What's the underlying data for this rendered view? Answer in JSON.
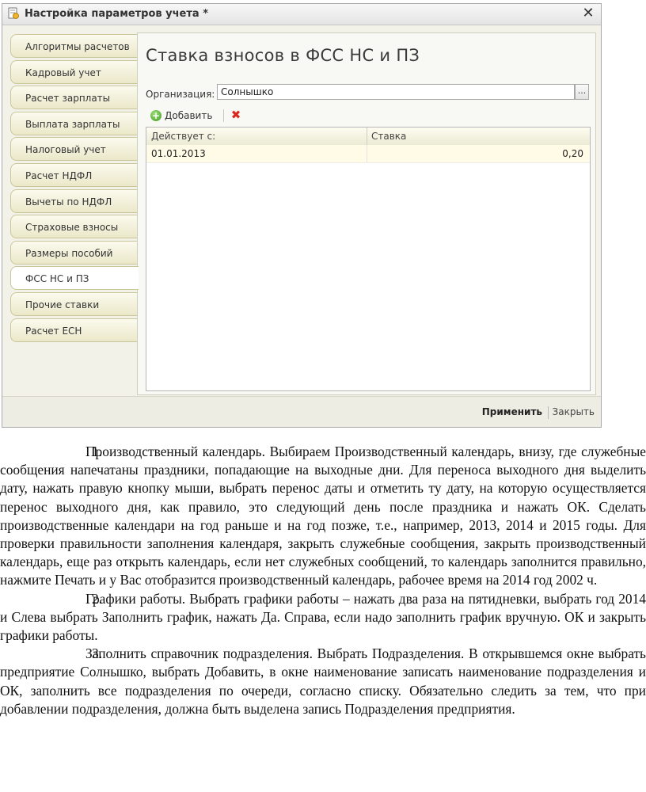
{
  "window": {
    "title": "Настройка параметров учета *",
    "close_symbol": "✕"
  },
  "tabs": [
    {
      "label": "Алгоритмы расчетов",
      "active": false
    },
    {
      "label": "Кадровый учет",
      "active": false
    },
    {
      "label": "Расчет зарплаты",
      "active": false
    },
    {
      "label": "Выплата зарплаты",
      "active": false
    },
    {
      "label": "Налоговый учет",
      "active": false
    },
    {
      "label": "Расчет НДФЛ",
      "active": false
    },
    {
      "label": "Вычеты по НДФЛ",
      "active": false
    },
    {
      "label": "Страховые взносы",
      "active": false
    },
    {
      "label": "Размеры пособий",
      "active": false
    },
    {
      "label": "ФСС НС и ПЗ",
      "active": true
    },
    {
      "label": "Прочие ставки",
      "active": false
    },
    {
      "label": "Расчет ЕСН",
      "active": false
    }
  ],
  "panel": {
    "title": "Ставка взносов в ФСС НС и ПЗ",
    "org_label": "Организация:",
    "org_value": "Солнышко",
    "org_button": "...",
    "add_label": "Добавить",
    "add_icon": "+",
    "delete_icon": "✖"
  },
  "grid": {
    "headers": [
      "Действует с:",
      "Ставка"
    ],
    "rows": [
      {
        "date": "01.01.2013",
        "rate": "0,20"
      }
    ]
  },
  "footer": {
    "apply_label": "Применить",
    "close_label": "Закрыть"
  },
  "colors": {
    "window_bg": "#f3f2e9",
    "tab_bg": "#ebe8c9",
    "delete_icon": "#d8281e",
    "add_icon": "#3f9a22"
  },
  "document": {
    "items": [
      {
        "num": "1.",
        "text": "Производственный календарь. Выбираем Производственный календарь, внизу, где служебные сообщения напечатаны праздники, попадающие на выходные дни. Для переноса выходного дня выделить дату, нажать правую кнопку мыши, выбрать перенос даты и отметить ту дату, на которую осуществляется перенос выходного дня, как правило, это следующий день после праздника и нажать ОК. Сделать производственные календари на год раньше и на год позже, т.е., например, 2013, 2014 и 2015 годы. Для проверки правильности заполнения календаря, закрыть служебные сообщения, закрыть производственный календарь, еще раз открыть календарь, если нет служебных сообщений, то календарь заполнится правильно, нажмите Печать и у Вас отобразится производственный календарь, рабочее время на 2014 год 2002 ч."
      },
      {
        "num": "2.",
        "text": "Графики работы. Выбрать графики работы – нажать два раза на пятидневки, выбрать год 2014 и Слева выбрать Заполнить график, нажать Да. Справа, если надо заполнить график вручную. ОК и закрыть графики работы."
      },
      {
        "num": "3.",
        "text": "Заполнить справочник подразделения. Выбрать Подразделения. В открывшемся окне выбрать предприятие Солнышко, выбрать Добавить, в окне наименование записать наименование подразделения и ОК, заполнить все подразделения по очереди, согласно списку. Обязательно следить за тем, что при добавлении подразделения, должна быть выделена запись Подразделения предприятия."
      }
    ]
  }
}
